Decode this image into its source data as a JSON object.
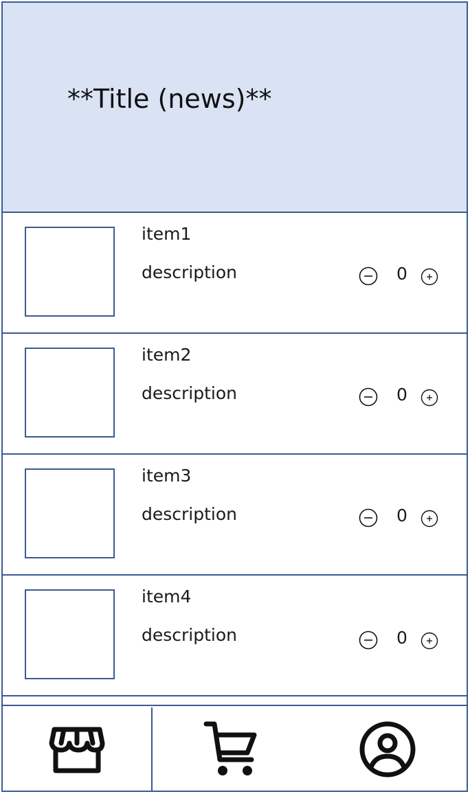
{
  "header": {
    "title": "**Title (news)**",
    "background": "#D9E3F3"
  },
  "accent_color": "#3A5A92",
  "items": [
    {
      "name": "item1",
      "description": "description",
      "quantity": "0"
    },
    {
      "name": "item2",
      "description": "description",
      "quantity": "0"
    },
    {
      "name": "item3",
      "description": "description",
      "quantity": "0"
    },
    {
      "name": "item4",
      "description": "description",
      "quantity": "0"
    }
  ],
  "stepper_icons": {
    "decrement": "minus-circle-icon",
    "increment": "plus-circle-icon"
  },
  "tabbar": {
    "tabs": [
      {
        "icon": "store-icon"
      },
      {
        "icon": "cart-icon"
      },
      {
        "icon": "user-circle-icon"
      }
    ]
  }
}
